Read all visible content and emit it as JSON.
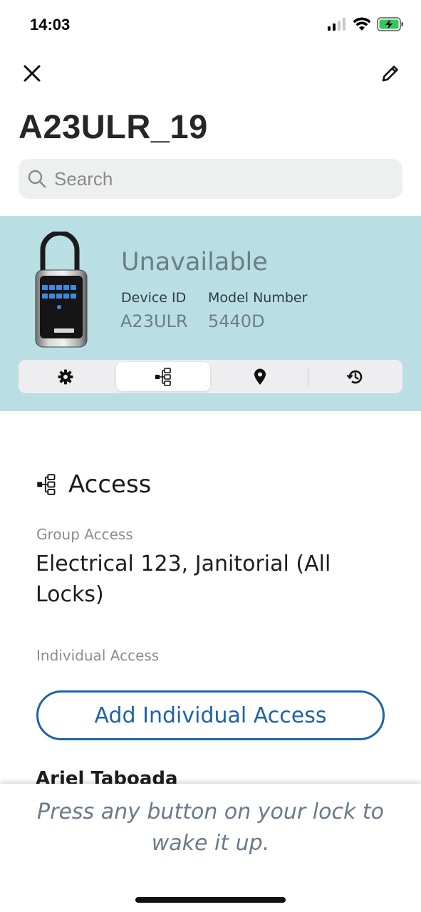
{
  "status_bar": {
    "time": "14:03"
  },
  "header": {
    "title": "A23ULR_19"
  },
  "search": {
    "placeholder": "Search"
  },
  "device": {
    "status": "Unavailable",
    "device_id_label": "Device ID",
    "device_id": "A23ULR",
    "model_label": "Model Number",
    "model": "5440D"
  },
  "tabs": [
    {
      "name": "settings",
      "icon": "gear-icon",
      "active": false
    },
    {
      "name": "access",
      "icon": "hierarchy-icon",
      "active": true
    },
    {
      "name": "location",
      "icon": "location-pin-icon",
      "active": false
    },
    {
      "name": "history",
      "icon": "history-icon",
      "active": false
    }
  ],
  "access": {
    "heading": "Access",
    "group_label": "Group Access",
    "group_value": "Electrical 123, Janitorial (All Locks)",
    "individual_label": "Individual Access",
    "add_button": "Add Individual Access",
    "users": [
      "Ariel Taboada"
    ]
  },
  "bottom_message": "Press any button on your lock to wake it up.",
  "colors": {
    "panel_bg": "#b9dee4",
    "accent_blue": "#1d64a6",
    "status_grey": "#6c7e86",
    "battery_green": "#34c759"
  }
}
